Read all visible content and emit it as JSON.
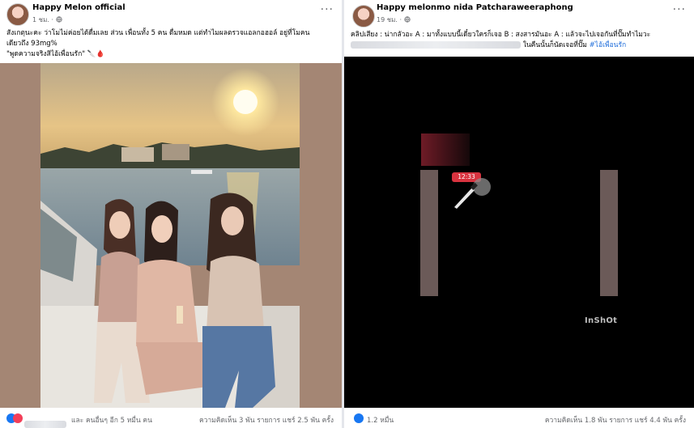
{
  "left_post": {
    "page_name": "Happy Melon official",
    "time": "1 ชม. ·",
    "privacy_icon": "globe-icon",
    "caption_lines": [
      "สังเกตุนะคะ ว่าโมไม่ค่อยได้ดื่มเลย ส่วน เพื่อนทั้ง 5 คน ดื่มหมด  แต่ทำไมผลตรวจแอลกอฮอล์ อยู่ที่โมคน",
      "เดียวถึง 93mg%",
      "\"พูดความจริงสิไอ้เพื่อนรัก\" 🔪🩸"
    ],
    "footer_reactions": "และ คนอื่นๆ อีก 5 หมื่น คน",
    "footer_stats": "ความคิดเห็น 3 พัน รายการ  แชร์ 2.5 พัน ครั้ง"
  },
  "right_post": {
    "page_name": "Happy melonmo nida Patcharaweeraphong",
    "time": "19 ชม. ·",
    "privacy_icon": "globe-icon",
    "caption_line1": "คลิปเสียง : น่ากลัวอะ A : มาทั้งแบบนี้เดี๋ยวใครก็เจอ B : สงสารมันอะ A : แล้วจะไปเจอกันที่ปั๊มทำไมวะ",
    "caption_line2": "ในคืนนั้นก็นัดเจอที่ปั๊ม",
    "hashtag": "#ไอ้เพื่อนรัก",
    "video_time": "12:33",
    "watermark": "InShOt",
    "footer_reactions": "1.2 หมื่น",
    "footer_stats": "ความคิดเห็น 1.8 พัน รายการ  แชร์ 4.4 พัน ครั้ง"
  },
  "colors": {
    "accent": "#216fdb",
    "like": "#1877f2",
    "love": "#f33e58",
    "frame": "#a48674"
  }
}
